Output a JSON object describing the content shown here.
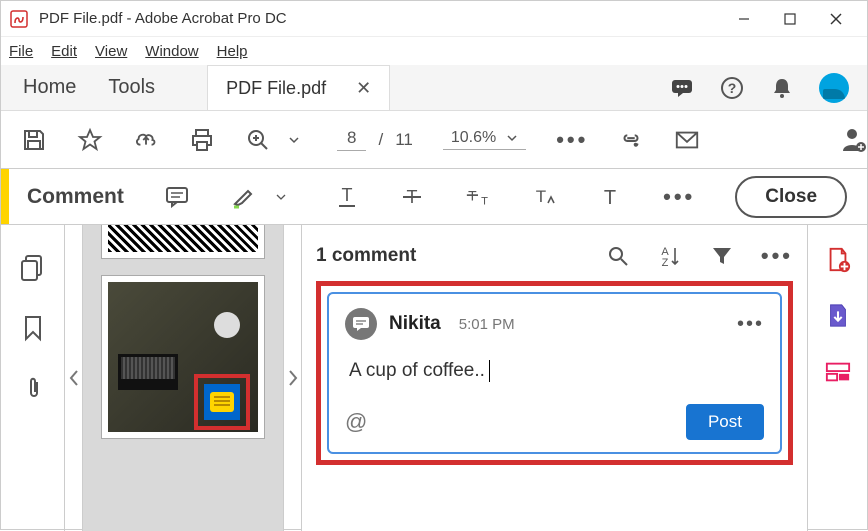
{
  "window": {
    "title": "PDF File.pdf - Adobe Acrobat Pro DC"
  },
  "menubar": {
    "file": "File",
    "edit": "Edit",
    "view": "View",
    "window": "Window",
    "help": "Help"
  },
  "tabs": {
    "home": "Home",
    "tools": "Tools",
    "file": "PDF File.pdf"
  },
  "toolbar": {
    "page_current": "8",
    "page_sep": "/",
    "page_total": "11",
    "zoom": "10.6%"
  },
  "comment_bar": {
    "title": "Comment",
    "close": "Close"
  },
  "panel": {
    "header": "1 comment",
    "author": "Nikita",
    "time": "5:01 PM",
    "body": "A cup of coffee..",
    "mention": "@",
    "post": "Post"
  }
}
